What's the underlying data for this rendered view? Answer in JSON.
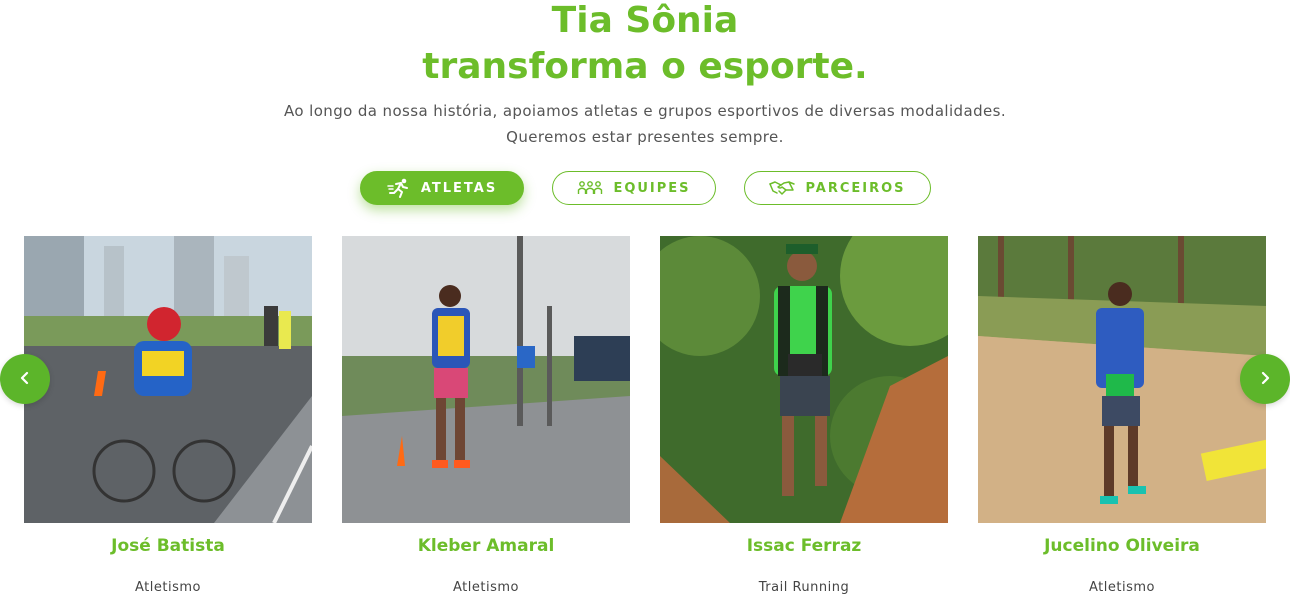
{
  "hero": {
    "title_line1": "Tia Sônia",
    "title_line2": "transforma o esporte.",
    "subtitle_line1": "Ao longo da nossa história, apoiamos atletas e grupos esportivos de diversas modalidades.",
    "subtitle_line2": "Queremos estar presentes sempre."
  },
  "tabs": [
    {
      "label": "ATLETAS",
      "icon": "runner-icon",
      "active": true
    },
    {
      "label": "EQUIPES",
      "icon": "group-icon",
      "active": false
    },
    {
      "label": "PARCEIROS",
      "icon": "handshake-icon",
      "active": false
    }
  ],
  "athletes": [
    {
      "name": "José Batista",
      "sport": "Atletismo"
    },
    {
      "name": "Kleber Amaral",
      "sport": "Atletismo"
    },
    {
      "name": "Issac Ferraz",
      "sport": "Trail Running"
    },
    {
      "name": "Jucelino Oliveira",
      "sport": "Atletismo"
    }
  ],
  "carousel": {
    "prev_icon": "chevron-left-icon",
    "next_icon": "chevron-right-icon"
  },
  "colors": {
    "accent": "#6cbd2a",
    "arrow": "#5cb52a"
  }
}
